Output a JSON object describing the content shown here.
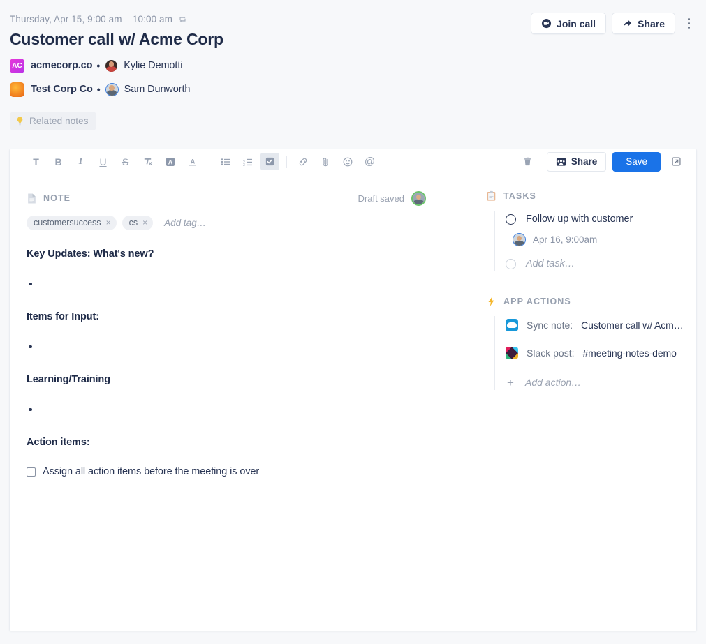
{
  "header": {
    "datetime": "Thursday, Apr 15, 9:00 am – 10:00 am",
    "recurring_icon": "recurring-icon",
    "title": "Customer call w/ Acme Corp",
    "join_call_label": "Join call",
    "share_label": "Share",
    "attendees": [
      {
        "org_initials": "AC",
        "org_name": "acmecorp.co",
        "separator": "•",
        "person": "Kylie Demotti"
      },
      {
        "org_initials": "",
        "org_name": "Test Corp Co",
        "separator": "•",
        "person": "Sam Dunworth"
      }
    ]
  },
  "related_notes": {
    "label": "Related notes",
    "icon": "lightbulb-icon"
  },
  "toolbar": {
    "items": [
      {
        "name": "text-style",
        "glyph": "T",
        "active": false
      },
      {
        "name": "bold",
        "glyph": "B",
        "active": false
      },
      {
        "name": "italic",
        "glyph": "I",
        "active": false
      },
      {
        "name": "underline",
        "glyph": "U",
        "active": false
      },
      {
        "name": "strikethrough",
        "glyph": "S",
        "active": false
      },
      {
        "name": "clear-formatting",
        "glyph": "T",
        "active": false
      },
      {
        "name": "highlight-color",
        "glyph": "A",
        "active": false
      },
      {
        "name": "text-color",
        "glyph": "A",
        "active": false
      },
      {
        "name": "bulleted-list",
        "glyph": "",
        "active": false
      },
      {
        "name": "numbered-list",
        "glyph": "",
        "active": false
      },
      {
        "name": "checklist",
        "glyph": "",
        "active": true
      },
      {
        "name": "link",
        "glyph": "",
        "active": false
      },
      {
        "name": "attachment",
        "glyph": "",
        "active": false
      },
      {
        "name": "emoji",
        "glyph": "",
        "active": false
      },
      {
        "name": "mention",
        "glyph": "@",
        "active": false
      }
    ],
    "delete_icon": "trash-icon",
    "share_label": "Share",
    "save_label": "Save",
    "popout_icon": "external-link-icon"
  },
  "note": {
    "section_label": "NOTE",
    "draft_status": "Draft saved",
    "tags": [
      {
        "label": "customersuccess",
        "remove": "×"
      },
      {
        "label": "cs",
        "remove": "×"
      }
    ],
    "add_tag_placeholder": "Add tag…",
    "blocks": [
      {
        "type": "heading",
        "text": "Key Updates: What's new?"
      },
      {
        "type": "bullet",
        "text": ""
      },
      {
        "type": "heading",
        "text": "Items for Input:"
      },
      {
        "type": "bullet",
        "text": ""
      },
      {
        "type": "heading",
        "text": "Learning/Training"
      },
      {
        "type": "bullet",
        "text": ""
      },
      {
        "type": "heading",
        "text": "Action items:"
      },
      {
        "type": "checkbox",
        "text": "Assign all action items before the meeting is over",
        "checked": false
      }
    ]
  },
  "tasks": {
    "section_label": "TASKS",
    "icon": "clipboard-icon",
    "items": [
      {
        "title": "Follow up with customer",
        "due": "Apr 16, 9:00am",
        "done": false
      }
    ],
    "add_task_placeholder": "Add task…"
  },
  "app_actions": {
    "section_label": "APP ACTIONS",
    "icon": "lightning-icon",
    "items": [
      {
        "icon": "salesforce-icon",
        "label": "Sync note:",
        "value": "Customer call w/ Acme …"
      },
      {
        "icon": "slack-icon",
        "label": "Slack post:",
        "value": "#meeting-notes-demo"
      }
    ],
    "add_action_placeholder": "Add action…"
  },
  "colors": {
    "accent_blue": "#1a73e8",
    "text_dark": "#2a3655",
    "text_muted": "#9aa2b1",
    "page_bg": "#f7f8fa"
  }
}
